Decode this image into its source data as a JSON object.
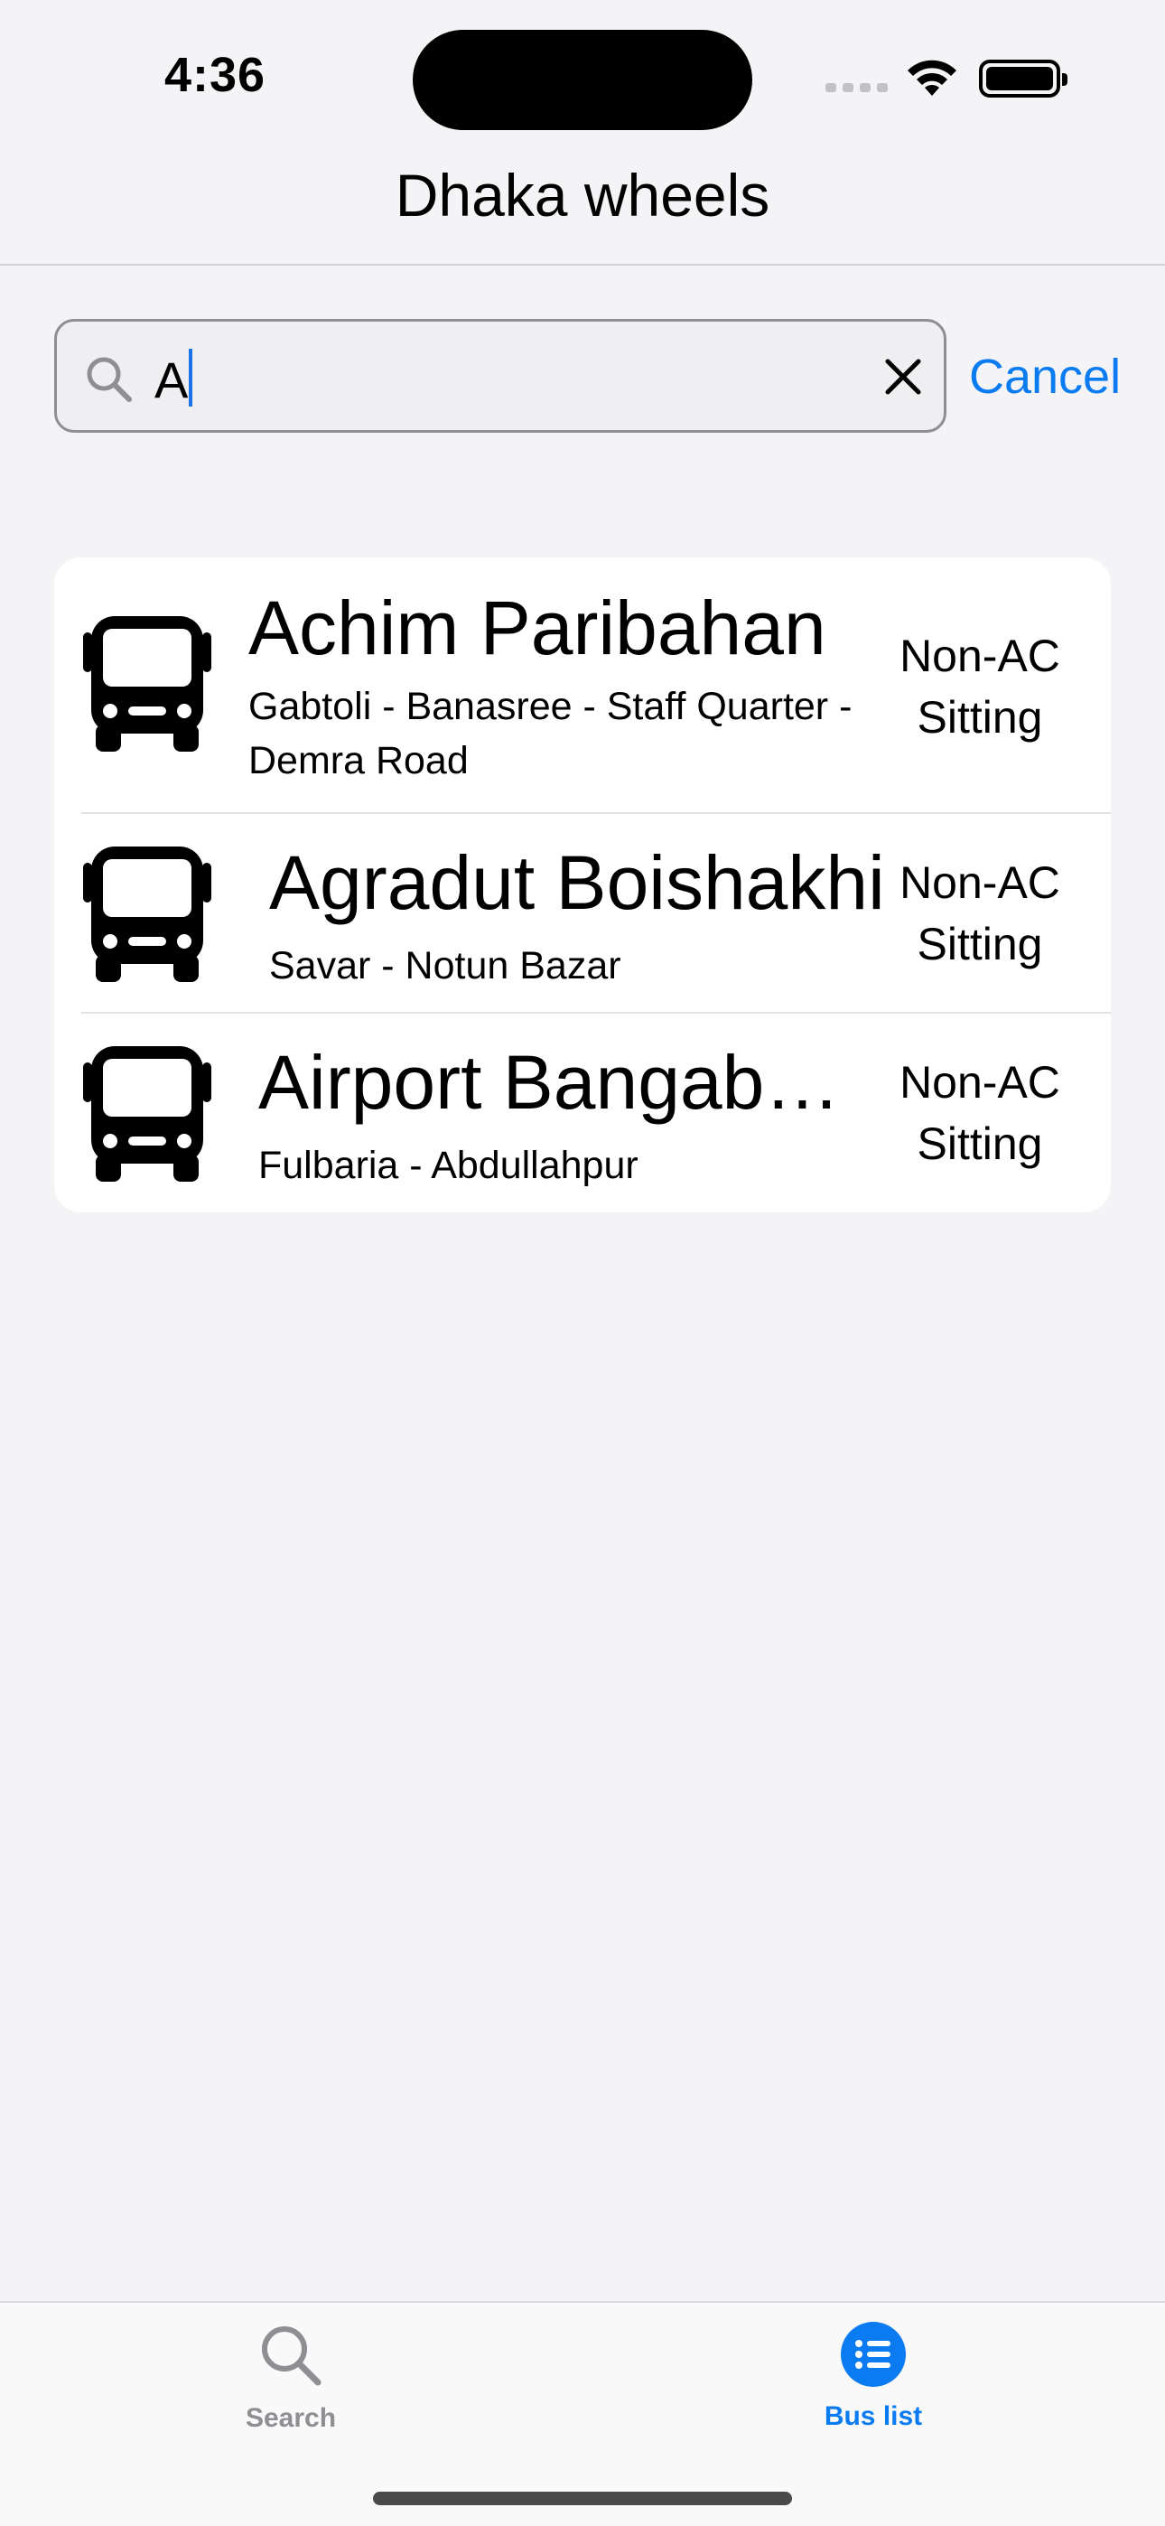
{
  "status_bar": {
    "time": "4:36"
  },
  "nav": {
    "title": "Dhaka wheels"
  },
  "search": {
    "value": "A",
    "cancel_label": "Cancel"
  },
  "buses": [
    {
      "name": "Achim Paribahan",
      "route": "Gabtoli - Banasree - Staff Quarter - Demra Road",
      "type_line1": "Non-AC",
      "type_line2": "Sitting",
      "icon": "bus-icon"
    },
    {
      "name": "Agradut Boishakhi",
      "route": "Savar - Notun Bazar",
      "type_line1": "Non-AC",
      "type_line2": "Sitting",
      "icon": "bus-icon"
    },
    {
      "name": "Airport Bangabandhu",
      "route": "Fulbaria - Abdullahpur",
      "type_line1": "Non-AC",
      "type_line2": "Sitting",
      "icon": "bus-icon"
    }
  ],
  "tabs": [
    {
      "label": "Search",
      "icon": "magnifier-icon",
      "selected": false
    },
    {
      "label": "Bus list",
      "icon": "list-icon",
      "selected": true
    }
  ],
  "colors": {
    "accent": "#0a7bf0",
    "background": "#f4f4f6",
    "inactive": "#8e8e93"
  }
}
